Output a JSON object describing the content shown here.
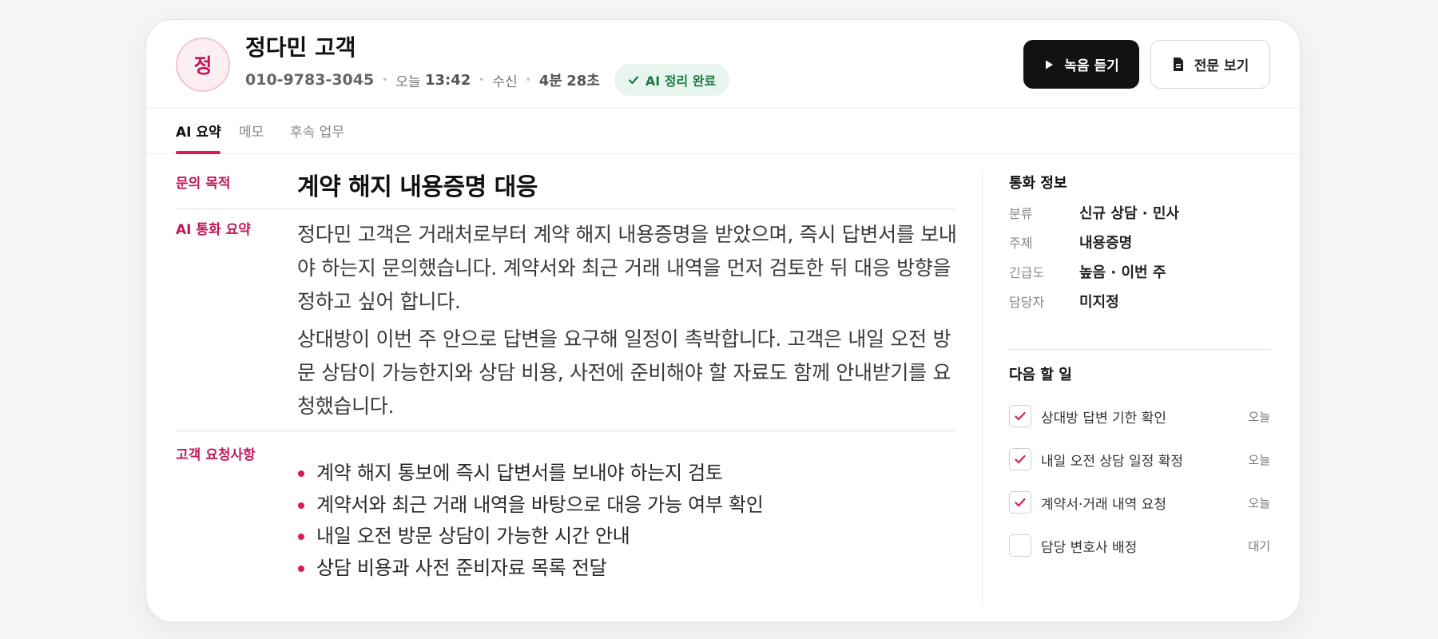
{
  "header": {
    "avatar_initial": "정",
    "customer_name": "정다민 고객",
    "phone": "010-9783-3045",
    "day": "오늘",
    "time": "13:42",
    "direction": "수신",
    "duration_min": "4분",
    "duration_sec": "28초",
    "badge": "AI 정리 완료",
    "listen_button": "녹음 듣기",
    "transcript_button": "전문 보기"
  },
  "tabs": [
    {
      "label": "AI 요약"
    },
    {
      "label": "메모"
    },
    {
      "label": "후속 업무"
    }
  ],
  "main": {
    "purpose_label": "문의 목적",
    "purpose_title": "계약 해지 내용증명 대응",
    "summary_label": "AI 통화 요약",
    "summary_paragraphs": [
      "정다민 고객은 거래처로부터 계약 해지 내용증명을 받았으며, 즉시 답변서를 보내야 하는지 문의했습니다. 계약서와 최근 거래 내역을 먼저 검토한 뒤 대응 방향을 정하고 싶어 합니다.",
      "상대방이 이번 주 안으로 답변을 요구해 일정이 촉박합니다. 고객은 내일 오전 방문 상담이 가능한지와 상담 비용, 사전에 준비해야 할 자료도 함께 안내받기를 요청했습니다."
    ],
    "requests_label": "고객 요청사항",
    "requests": [
      "계약 해지 통보에 즉시 답변서를 보내야 하는지 검토",
      "계약서와 최근 거래 내역을 바탕으로 대응 가능 여부 확인",
      "내일 오전 방문 상담이 가능한 시간 안내",
      "상담 비용과 사전 준비자료 목록 전달"
    ]
  },
  "call_info": {
    "title": "통화 정보",
    "rows": [
      {
        "key": "분류",
        "value": "신규 상담 · 민사"
      },
      {
        "key": "주제",
        "value": "내용증명"
      },
      {
        "key": "긴급도",
        "value": "높음 · 이번 주"
      },
      {
        "key": "담당자",
        "value": "미지정"
      }
    ]
  },
  "todos": {
    "title": "다음 할 일",
    "items": [
      {
        "text": "상대방 답변 기한 확인",
        "due": "오늘",
        "checked": true
      },
      {
        "text": "내일 오전 상담 일정 확정",
        "due": "오늘",
        "checked": true
      },
      {
        "text": "계약서·거래 내역 요청",
        "due": "오늘",
        "checked": true
      },
      {
        "text": "담당 변호사 배정",
        "due": "대기",
        "checked": false
      }
    ]
  },
  "colors": {
    "accent": "#d81b60",
    "success": "#1e7a44",
    "primary_button": "#121212"
  }
}
